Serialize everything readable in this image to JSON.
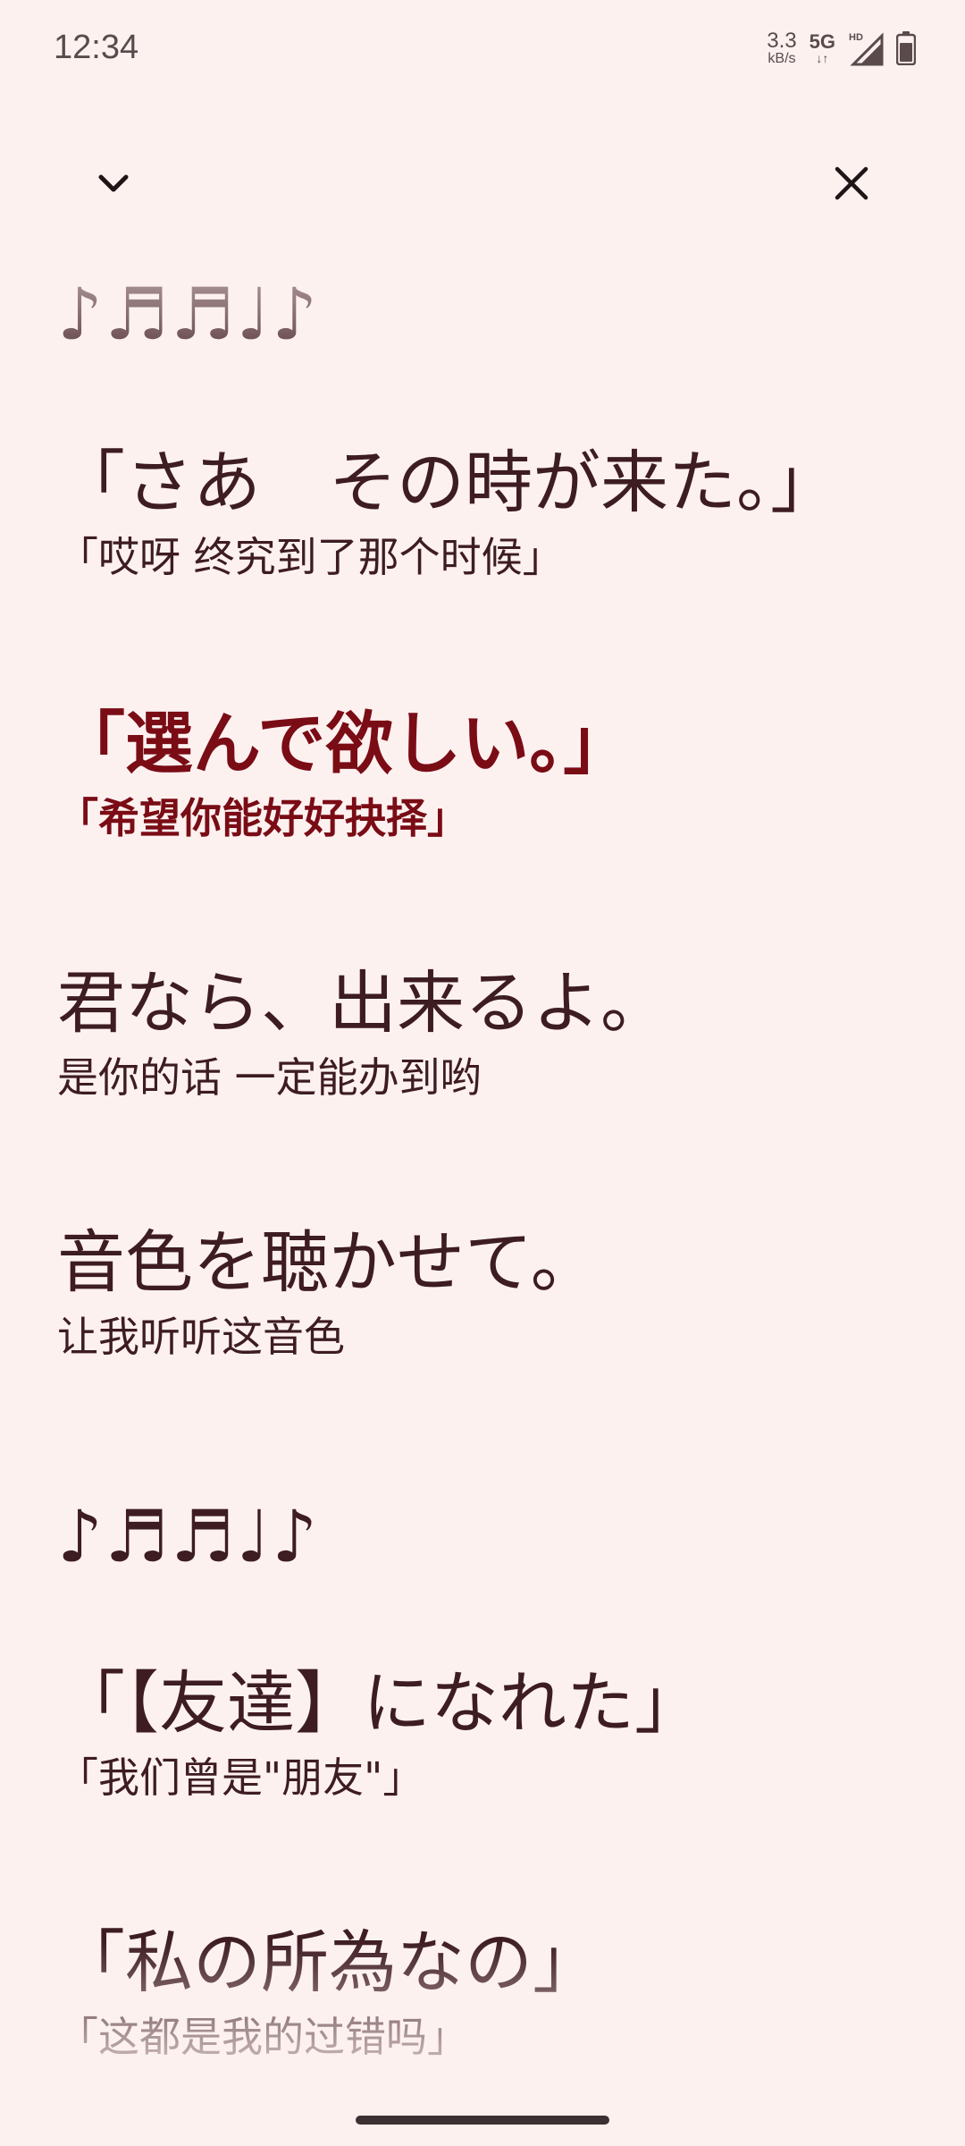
{
  "status_bar": {
    "time": "12:34",
    "net_speed_value": "3.3",
    "net_speed_unit": "kB/s",
    "network_type": "5G",
    "network_arrows": "↓↑",
    "hd_label": "HD"
  },
  "controls": {
    "collapse_icon": "chevron-down-icon",
    "close_icon": "close-icon"
  },
  "lyrics": [
    {
      "original": "♪♬♬♩♪",
      "translation": ""
    },
    {
      "original": "「さあ　その時が来た。」",
      "translation": "「哎呀 终究到了那个时候」"
    },
    {
      "original": "「選んで欲しい。」",
      "translation": "「希望你能好好抉择」",
      "active": true
    },
    {
      "original": "君なら、出来るよ。",
      "translation": "是你的话 一定能办到哟"
    },
    {
      "original": "音色を聴かせて。",
      "translation": "让我听听这音色"
    },
    {
      "original": "♪♬♬♩♪",
      "translation": ""
    },
    {
      "original": "「【友達】になれた」",
      "translation": "「我们曾是\"朋友\"」"
    },
    {
      "original": "「私の所為なの」",
      "translation": "「这都是我的过错吗」"
    }
  ],
  "colors": {
    "background": "#fdf1f0",
    "lyric_text": "#3d1c22",
    "active_lyric": "#7a0c15"
  }
}
